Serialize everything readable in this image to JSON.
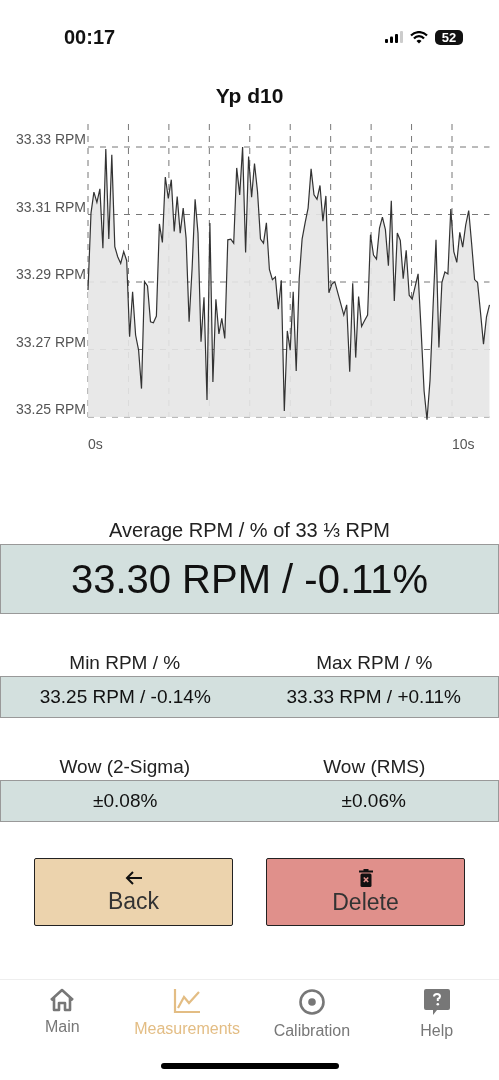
{
  "status_bar": {
    "time": "00:17",
    "battery": "52"
  },
  "chart": {
    "title": "Yp d10",
    "y_axis_labels": [
      "33.33 RPM",
      "33.31 RPM",
      "33.29 RPM",
      "33.27 RPM",
      "33.25 RPM"
    ],
    "x_axis_labels": [
      "0s",
      "10s"
    ]
  },
  "average": {
    "label": "Average RPM / % of 33 ⅓ RPM",
    "value": "33.30 RPM / -0.11%"
  },
  "stats": [
    {
      "label": "Min RPM / %",
      "value": "33.25 RPM / -0.14%"
    },
    {
      "label": "Max RPM / %",
      "value": "33.33 RPM / +0.11%"
    }
  ],
  "wow": [
    {
      "label": "Wow (2-Sigma)",
      "value": "±0.08%"
    },
    {
      "label": "Wow (RMS)",
      "value": "±0.06%"
    }
  ],
  "buttons": [
    {
      "kind": "back",
      "label": "Back"
    },
    {
      "kind": "delete",
      "label": "Delete"
    }
  ],
  "tabs": [
    {
      "kind": "home",
      "label": "Main",
      "selected": false
    },
    {
      "kind": "chart",
      "label": "Measurements",
      "selected": true
    },
    {
      "kind": "target",
      "label": "Calibration",
      "selected": false
    },
    {
      "kind": "help",
      "label": "Help",
      "selected": false
    }
  ]
}
